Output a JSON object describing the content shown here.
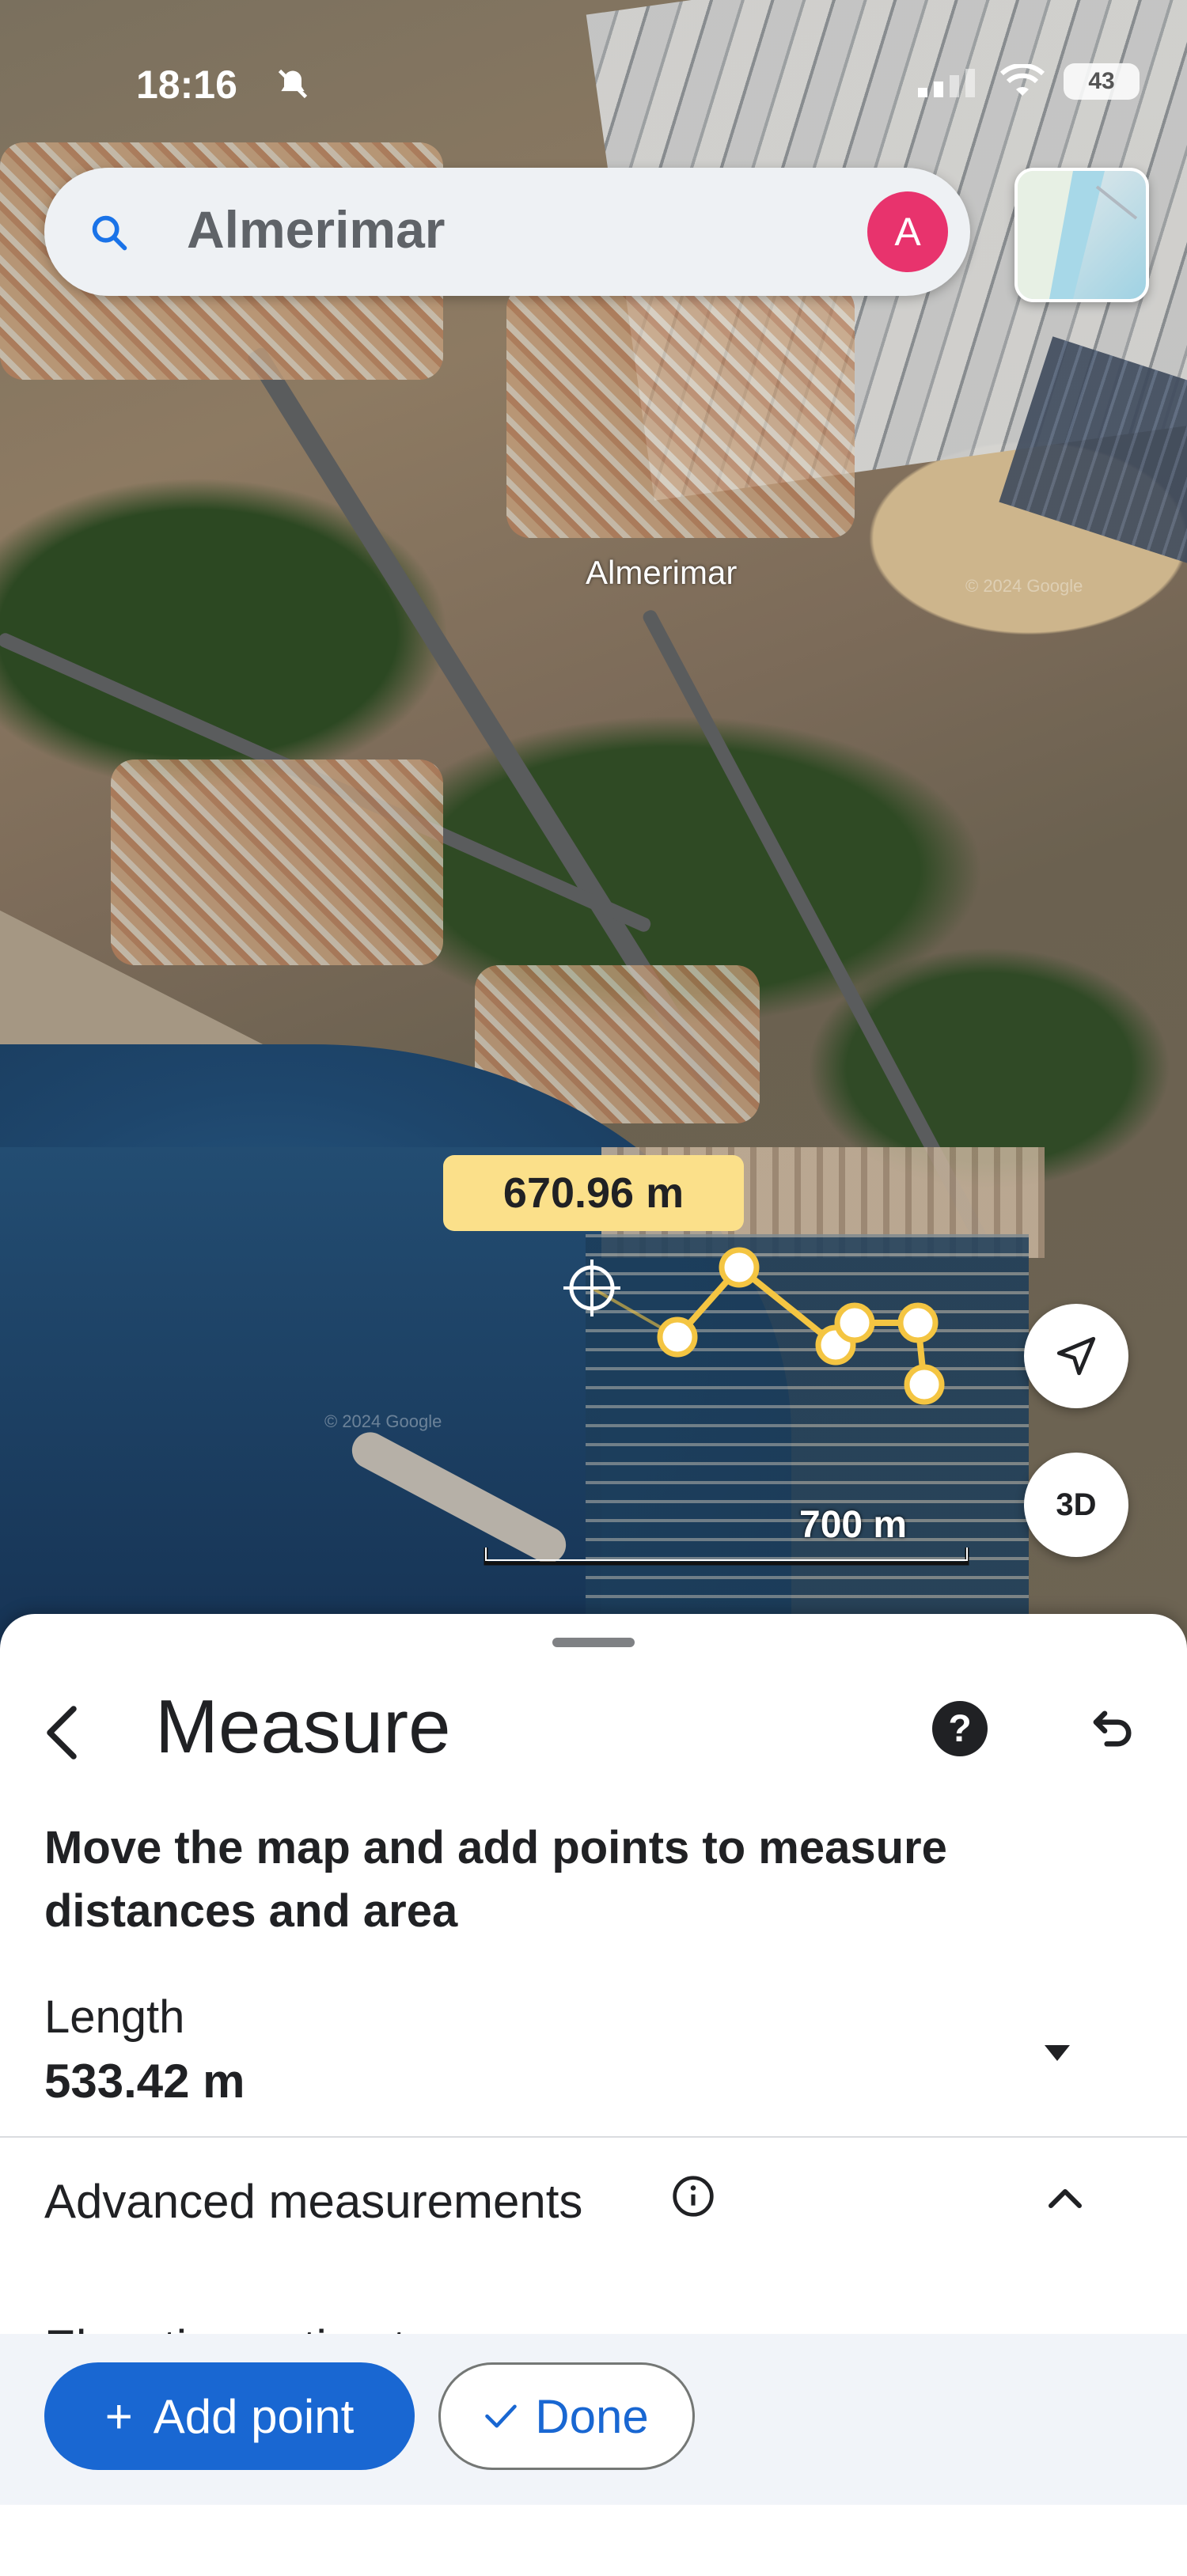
{
  "status_bar": {
    "time": "18:16",
    "battery": "43"
  },
  "search": {
    "query": "Almerimar",
    "avatar_letter": "A"
  },
  "map": {
    "place_label": "Almerimar",
    "watermark": "© 2024 Google",
    "distance_badge": "670.96 m",
    "scale_label": "700 m",
    "three_d_label": "3D",
    "route_color": "#f4c542"
  },
  "sheet": {
    "title": "Measure",
    "instructions": "Move the map and add points to measure distances and area",
    "length_label": "Length",
    "length_value": "533.42 m",
    "advanced_label": "Advanced measurements",
    "partial_row": "Elevation estimate"
  },
  "actions": {
    "add_point": "Add point",
    "done": "Done"
  },
  "icons": {
    "search": "search-icon",
    "back": "back-arrow-icon",
    "help": "help-icon",
    "undo": "undo-icon",
    "info": "info-icon",
    "navigate": "navigation-arrow-icon"
  },
  "colors": {
    "accent": "#1967d2",
    "avatar": "#e8336d",
    "badge": "#fbe08a"
  }
}
